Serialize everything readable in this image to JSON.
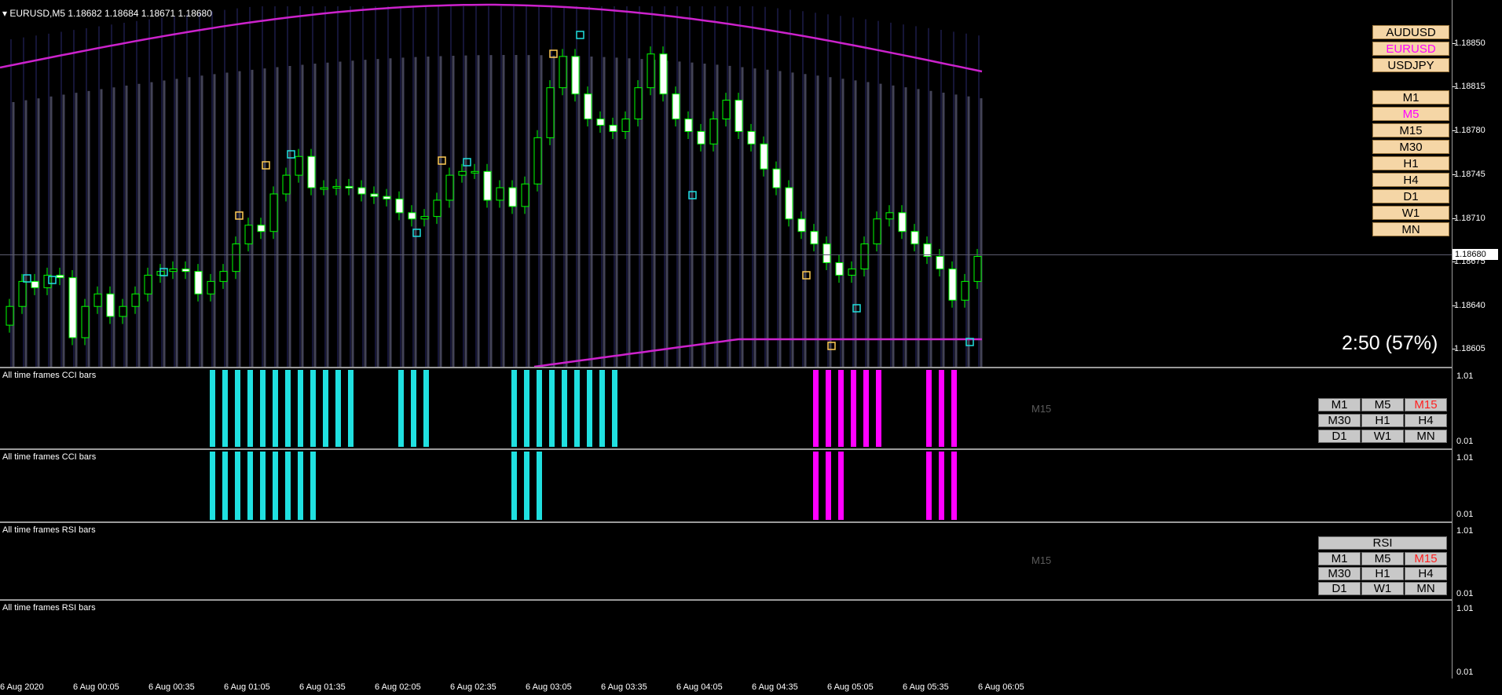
{
  "chart": {
    "title": "EURUSD,M5  1.18682 1.18684 1.18671 1.18680",
    "current_price": "1.18680",
    "timer": "2:50 (57%)",
    "price_ticks": [
      "1.18850",
      "1.18815",
      "1.18780",
      "1.18745",
      "1.18710",
      "1.18675",
      "1.18640",
      "1.18605"
    ],
    "symbols": [
      {
        "label": "AUDUSD",
        "color": "#000000"
      },
      {
        "label": "EURUSD",
        "color": "#ff00ff"
      },
      {
        "label": "USDJPY",
        "color": "#000000"
      }
    ],
    "timeframes": [
      {
        "label": "M1",
        "color": "#000000"
      },
      {
        "label": "M5",
        "color": "#ff00ff"
      },
      {
        "label": "M15",
        "color": "#000000"
      },
      {
        "label": "M30",
        "color": "#000000"
      },
      {
        "label": "H1",
        "color": "#000000"
      },
      {
        "label": "H4",
        "color": "#000000"
      },
      {
        "label": "D1",
        "color": "#000000"
      },
      {
        "label": "W1",
        "color": "#000000"
      },
      {
        "label": "MN",
        "color": "#000000"
      }
    ]
  },
  "panes": [
    {
      "label": "All time frames CCI bars",
      "max": "1.01",
      "min": "0.01",
      "ghost": "M15"
    },
    {
      "label": "All time frames CCI bars",
      "max": "1.01",
      "min": "0.01"
    },
    {
      "label": "All time frames RSI bars",
      "max": "1.01",
      "min": "0.01",
      "ghost": "M15",
      "header": "RSI"
    },
    {
      "label": "All time frames RSI bars",
      "max": "1.01",
      "min": "0.01"
    }
  ],
  "grid_buttons": [
    {
      "label": "M1",
      "color": "#000000"
    },
    {
      "label": "M5",
      "color": "#000000"
    },
    {
      "label": "M15",
      "color": "#ff2020"
    },
    {
      "label": "M30",
      "color": "#000000"
    },
    {
      "label": "H1",
      "color": "#000000"
    },
    {
      "label": "H4",
      "color": "#000000"
    },
    {
      "label": "D1",
      "color": "#000000"
    },
    {
      "label": "W1",
      "color": "#000000"
    },
    {
      "label": "MN",
      "color": "#000000"
    }
  ],
  "time_ticks": [
    "6 Aug 2020",
    "6 Aug 00:05",
    "6 Aug 00:35",
    "6 Aug 01:05",
    "6 Aug 01:35",
    "6 Aug 02:05",
    "6 Aug 02:35",
    "6 Aug 03:05",
    "6 Aug 03:35",
    "6 Aug 04:05",
    "6 Aug 04:35",
    "6 Aug 05:05",
    "6 Aug 05:35",
    "6 Aug 06:05"
  ],
  "colors": {
    "bull": "#00ff00",
    "bear_body": "#ffffff",
    "band": "#cc22cc",
    "cyan": "#20e0e0",
    "magenta": "#ff00ff",
    "history": "#7a7a9e"
  }
}
